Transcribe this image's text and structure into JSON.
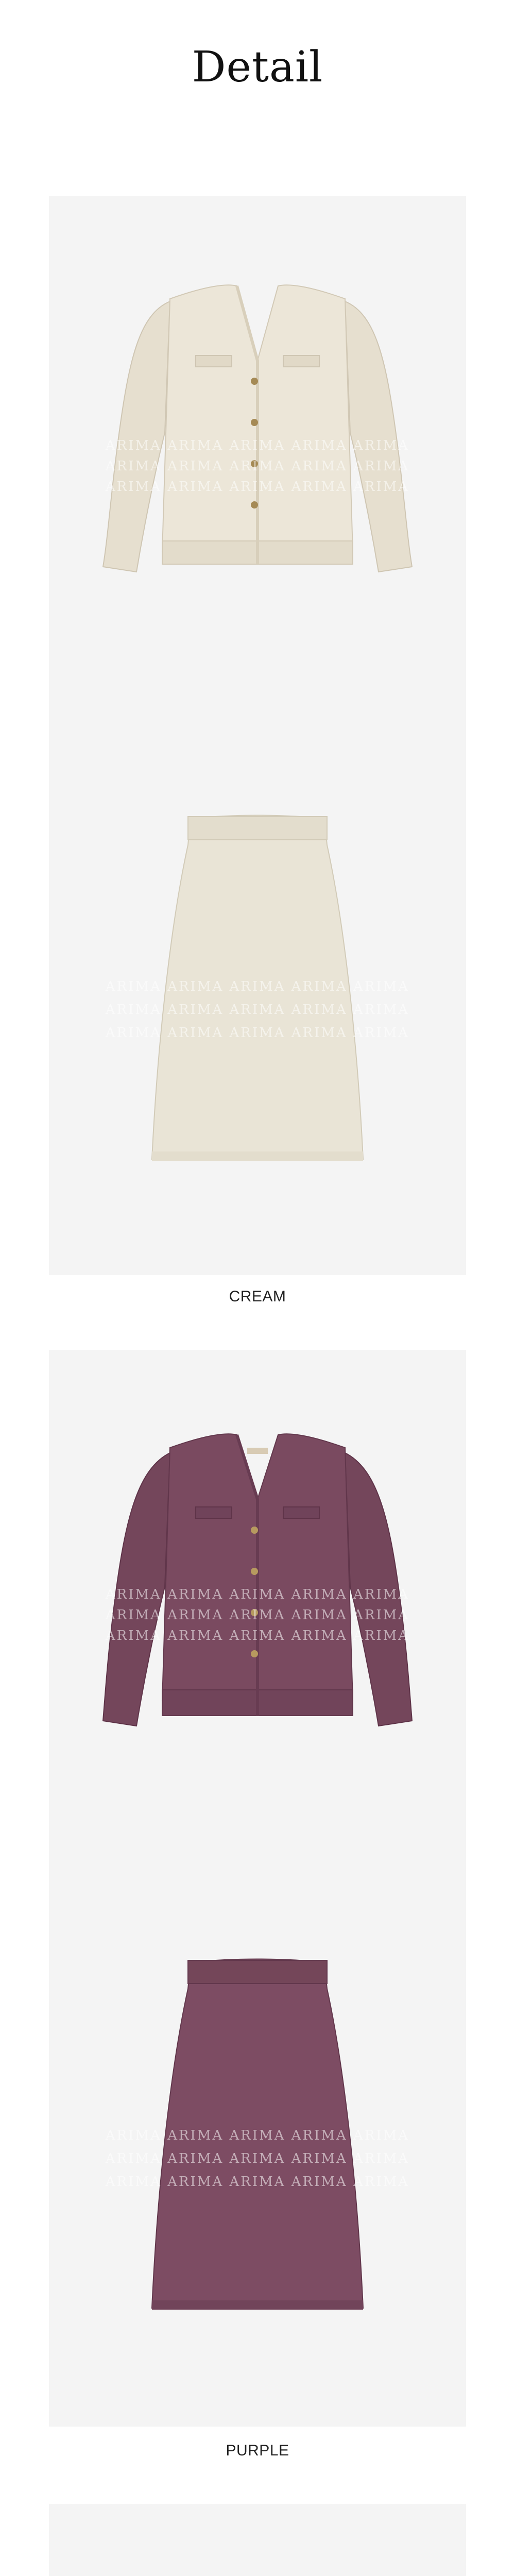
{
  "page": {
    "title": "Detail"
  },
  "watermark": {
    "text": "ARIMA ARIMA ARIMA ARIMA ARIMA"
  },
  "variants": [
    {
      "caption": "CREAM",
      "color": "#ece6d8",
      "shadow": "#d7cfbd",
      "items": [
        "cardigan",
        "skirt"
      ]
    },
    {
      "caption": "PURPLE",
      "color": "#7a4a60",
      "shadow": "#5f3449",
      "items": [
        "cardigan",
        "skirt"
      ]
    }
  ]
}
